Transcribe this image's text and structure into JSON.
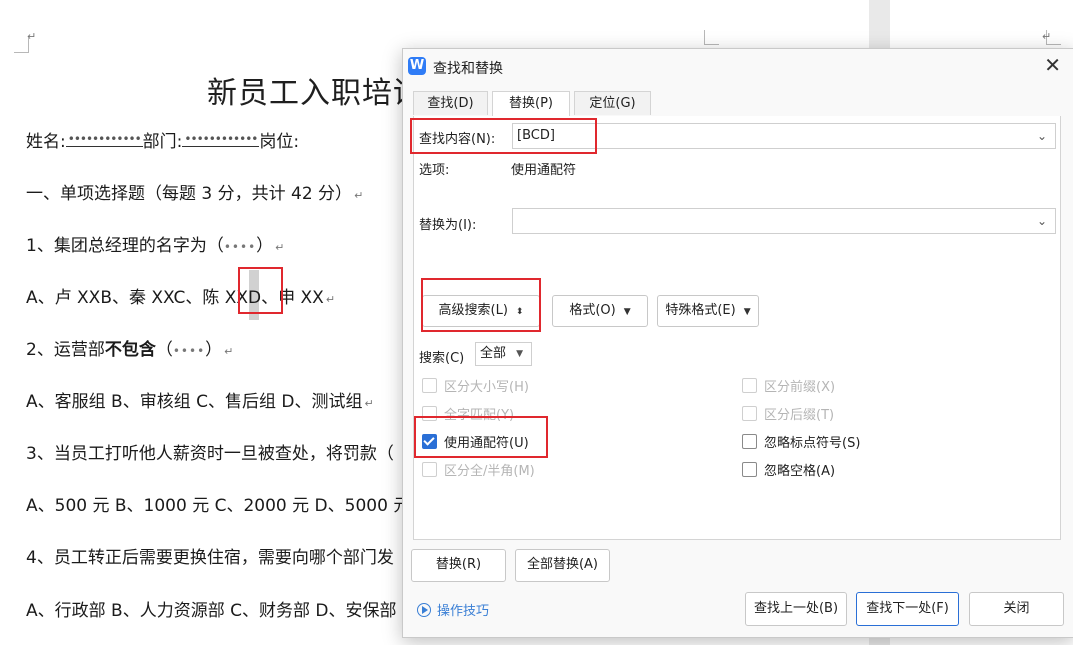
{
  "document": {
    "title": "新员工入职培训",
    "info_line": {
      "name_label": "姓名:",
      "dept_label": "部门:",
      "post_label": "岗位:",
      "blank": "••••••••••••"
    },
    "section_heading": "一、单项选择题（每题 3 分，共计 42 分）",
    "q1": "1、集团总经理的名字为（",
    "q1_end": "）",
    "q1_options_a": "A、卢 XXB、秦 XXC、陈 X",
    "q1_options_b": "XD",
    "q1_options_c": "、申 XX",
    "q2_prefix": "2、运营部",
    "q2_bold": "不包含",
    "q2_end": "（",
    "q2_end2": "）",
    "q2_options": "A、客服组 B、审核组 C、售后组 D、测试组",
    "q3": "3、当员工打听他人薪资时一旦被查处，将罚款（",
    "q3_options": "A、500 元 B、1000 元 C、2000 元 D、5000 元",
    "q4": "4、员工转正后需要更换住宿，需要向哪个部门发",
    "q4_options": "A、行政部 B、人力资源部 C、财务部 D、安保部",
    "blank_short": "••••",
    "paragraph_mark": "↵"
  },
  "dialog": {
    "title": "查找和替换",
    "tabs": [
      {
        "label": "查找(D)",
        "active": false
      },
      {
        "label": "替换(P)",
        "active": true
      },
      {
        "label": "定位(G)",
        "active": false
      }
    ],
    "find_label": "查找内容(N):",
    "find_value": "[BCD]",
    "options_label": "选项:",
    "options_value": "使用通配符",
    "replace_label": "替换为(I):",
    "replace_value": "",
    "advanced_button": "高级搜索(L)",
    "format_button": "格式(O)",
    "special_button": "特殊格式(E)",
    "search_label": "搜索(C)",
    "search_value": "全部",
    "checkboxes_left": [
      {
        "label": "区分大小写(H)",
        "checked": false,
        "enabled": false
      },
      {
        "label": "全字匹配(Y)",
        "checked": false,
        "enabled": false
      },
      {
        "label": "使用通配符(U)",
        "checked": true,
        "enabled": true
      },
      {
        "label": "区分全/半角(M)",
        "checked": false,
        "enabled": false
      }
    ],
    "checkboxes_right": [
      {
        "label": "区分前缀(X)",
        "checked": false,
        "enabled": false
      },
      {
        "label": "区分后缀(T)",
        "checked": false,
        "enabled": false
      },
      {
        "label": "忽略标点符号(S)",
        "checked": false,
        "enabled": true
      },
      {
        "label": "忽略空格(A)",
        "checked": false,
        "enabled": true
      }
    ],
    "replace_button": "替换(R)",
    "replace_all_button": "全部替换(A)",
    "tips_link": "操作技巧",
    "find_prev_button": "查找上一处(B)",
    "find_next_button": "查找下一处(F)",
    "close_button": "关闭"
  },
  "colors": {
    "accent": "#2a6fd6",
    "highlight_box": "#e0282e",
    "link": "#3a7fd5"
  }
}
